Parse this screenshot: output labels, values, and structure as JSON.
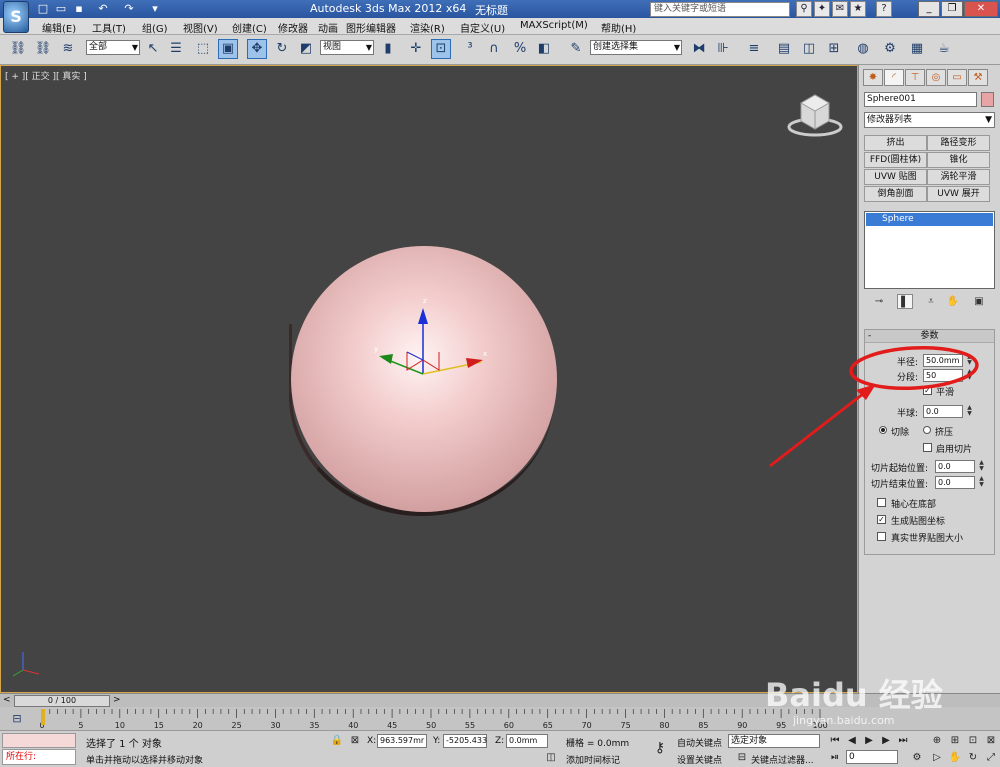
{
  "titlebar": {
    "app_title": "Autodesk 3ds Max  2012 x64",
    "doc_title": "无标题",
    "search_placeholder": "键入关键字或短语",
    "logo_glyph": "S"
  },
  "menu": [
    "编辑(E)",
    "工具(T)",
    "组(G)",
    "视图(V)",
    "创建(C)",
    "修改器",
    "动画",
    "图形编辑器",
    "渲染(R)",
    "自定义(U)",
    "MAXScript(M)",
    "帮助(H)"
  ],
  "toolbar": {
    "selection_filter": "全部",
    "ref_coord": "视图",
    "named_selection": "创建选择集"
  },
  "viewport": {
    "label": "[ + ][ 正交 ][ 真实 ]",
    "axis_labels": {
      "x": "x",
      "y": "y",
      "z": "z"
    }
  },
  "command_panel": {
    "object_name": "Sphere001",
    "object_color": "#e8a4a4",
    "modifier_list": "修改器列表",
    "modifier_buttons": [
      "挤出",
      "路径变形",
      "FFD(圆柱体)",
      "锥化",
      "UVW 贴图",
      "涡轮平滑",
      "倒角剖面",
      "UVW 展开"
    ],
    "stack_item": "Sphere",
    "rollout": {
      "title": "参数",
      "radius_label": "半径:",
      "radius_value": "50.0mm",
      "segments_label": "分段:",
      "segments_value": "50",
      "smooth_label": "平滑",
      "smooth_checked": true,
      "hemisphere_label": "半球:",
      "hemisphere_value": "0.0",
      "chop_label": "切除",
      "squash_label": "挤压",
      "slice_on_label": "启用切片",
      "slice_from_label": "切片起始位置:",
      "slice_from_value": "0.0",
      "slice_to_label": "切片结束位置:",
      "slice_to_value": "0.0",
      "base_pivot_label": "轴心在底部",
      "gen_mapping_label": "生成贴图坐标",
      "real_world_label": "真实世界贴图大小"
    }
  },
  "timeline": {
    "frame_display": "0 / 100",
    "ticks": [
      "0",
      "5",
      "10",
      "15",
      "20",
      "25",
      "30",
      "35",
      "40",
      "45",
      "50",
      "55",
      "60",
      "65",
      "70",
      "75",
      "80",
      "85",
      "90",
      "95",
      "100"
    ],
    "tick_values": [
      0,
      5,
      10,
      15,
      20,
      25,
      30,
      35,
      40,
      45,
      50,
      55,
      60,
      65,
      70,
      75,
      80,
      85,
      90,
      95,
      100
    ]
  },
  "status": {
    "running_label": "所在行:",
    "selection_text": "选择了 1 个 对象",
    "prompt_text": "单击并拖动以选择并移动对象",
    "x_label": "X:",
    "x_value": "963.597mr",
    "y_label": "Y:",
    "y_value": "-5205.433",
    "z_label": "Z:",
    "z_value": "0.0mm",
    "grid_text": "栅格 = 0.0mm",
    "add_tag": "添加时间标记",
    "auto_key": "自动关键点",
    "set_key": "设置关键点",
    "selection_dropdown": "选定对象",
    "key_filter": "关键点过滤器...",
    "frame_value": "0"
  },
  "watermark": {
    "text": "Baidu 经验",
    "url": "jingyan.baidu.com"
  },
  "annotation_color": "#e21b1b"
}
